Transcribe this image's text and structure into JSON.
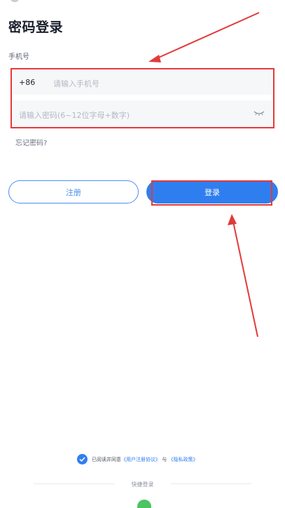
{
  "header": {
    "title": "密码登录"
  },
  "form": {
    "phone_label": "手机号",
    "country_code": "+86",
    "phone_placeholder": "请输入手机号",
    "password_placeholder": "请输入密码(6~12位字母+数字)",
    "forgot_label": "忘记密码?"
  },
  "buttons": {
    "register_label": "注册",
    "login_label": "登录"
  },
  "agreement": {
    "prefix": "已阅读并同意",
    "user_agreement": "《用户注册协议》",
    "conjunction": "与",
    "privacy_policy": "《隐私政策》",
    "checked": true
  },
  "quick_login": {
    "label": "快捷登录"
  },
  "colors": {
    "accent": "#2f7ef0",
    "annotation": "#e23a3a"
  }
}
